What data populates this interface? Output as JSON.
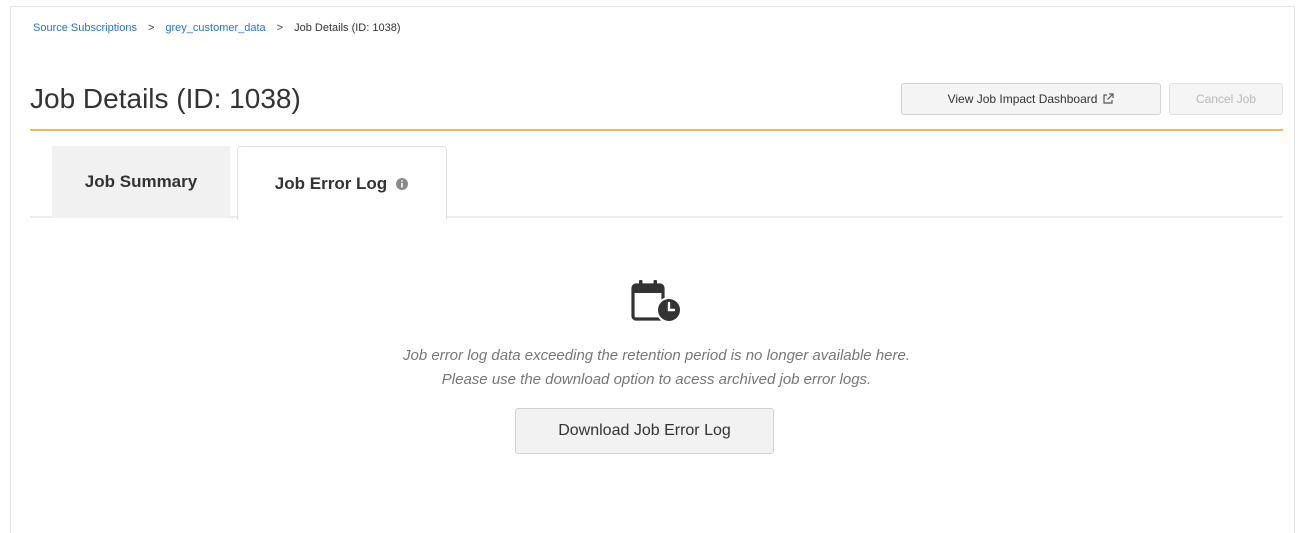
{
  "breadcrumb": {
    "items": [
      "Source Subscriptions",
      "grey_customer_data"
    ],
    "separator": ">",
    "current": "Job Details (ID: 1038)"
  },
  "header": {
    "title": "Job Details (ID: 1038)",
    "impact_button": "View Job Impact Dashboard",
    "impact_button_icon": "external-link-icon",
    "cancel_button": "Cancel Job",
    "cancel_button_disabled": true,
    "accent_color": "#f3b661"
  },
  "tabs": [
    {
      "label": "Job Summary",
      "active": false
    },
    {
      "label": "Job Error Log",
      "active": true,
      "icon": "info-icon"
    }
  ],
  "empty_state": {
    "icon": "calendar-clock-icon",
    "line1": "Job error log data exceeding the retention period is no longer available here.",
    "line2": "Please use the download option to acess archived job error logs.",
    "download_button": "Download Job Error Log"
  },
  "colors": {
    "link": "#2b73c6",
    "text": "#333333",
    "muted": "#777777"
  }
}
